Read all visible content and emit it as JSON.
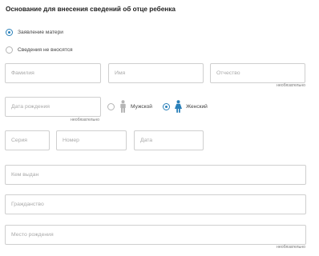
{
  "section": {
    "title": "Основание для внесения сведений об отце ребенка"
  },
  "basis_options": [
    {
      "label": "Заявление матери",
      "selected": true
    },
    {
      "label": "Сведения не вносятся",
      "selected": false
    }
  ],
  "fields": {
    "surname": {
      "placeholder": "Фамилия",
      "value": ""
    },
    "name": {
      "placeholder": "Имя",
      "value": ""
    },
    "patronymic": {
      "placeholder": "Отчество",
      "value": "",
      "note": "необязательно"
    },
    "birth_date": {
      "placeholder": "Дата рождения",
      "value": "",
      "note": "необязательно"
    },
    "doc_series": {
      "placeholder": "Серия",
      "value": ""
    },
    "doc_number": {
      "placeholder": "Номер",
      "value": ""
    },
    "doc_date": {
      "placeholder": "Дата",
      "value": ""
    },
    "issued_by": {
      "placeholder": "Кем выдан",
      "value": ""
    },
    "citizenship": {
      "placeholder": "Гражданство",
      "value": ""
    },
    "birth_place": {
      "placeholder": "Место рождения",
      "value": "",
      "note": "необязательно"
    }
  },
  "gender": {
    "male": {
      "label": "Мужской",
      "icon": "male-person-icon",
      "selected": false
    },
    "female": {
      "label": "Женский",
      "icon": "female-person-icon",
      "selected": true
    }
  },
  "colors": {
    "accent": "#2a80b9",
    "icon_inactive": "#b5b5b5",
    "border": "#cfcfcf"
  }
}
